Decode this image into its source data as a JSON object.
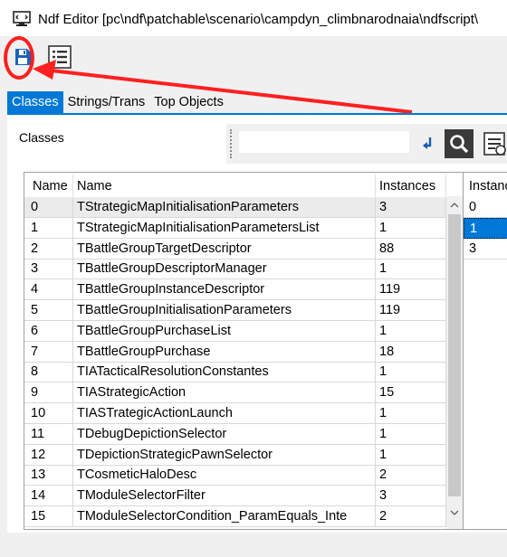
{
  "window": {
    "title": "Ndf Editor [pc\\ndf\\patchable\\scenario\\campdyn_climbnarodnaia\\ndfscript\\",
    "icon": "monitor-icon"
  },
  "toolbar": {
    "save_icon": "floppy-disk-icon",
    "list_icon": "list-view-icon"
  },
  "annotation": {
    "color": "#ff2020"
  },
  "tabs": [
    {
      "label": "Classes",
      "active": true
    },
    {
      "label": "Strings/Trans",
      "active": false
    },
    {
      "label": "Top Objects",
      "active": false
    }
  ],
  "classes_panel": {
    "label": "Classes",
    "search": {
      "value": "",
      "placeholder": ""
    },
    "icons": [
      "clear-arrow-icon",
      "search-icon",
      "properties-icon"
    ]
  },
  "class_table": {
    "columns": [
      "Name",
      "Name",
      "Instances"
    ],
    "rows": [
      [
        "0",
        "TStrategicMapInitialisationParameters",
        "3"
      ],
      [
        "1",
        "TStrategicMapInitialisationParametersList",
        "1"
      ],
      [
        "2",
        "TBattleGroupTargetDescriptor",
        "88"
      ],
      [
        "3",
        "TBattleGroupDescriptorManager",
        "1"
      ],
      [
        "4",
        "TBattleGroupInstanceDescriptor",
        "119"
      ],
      [
        "5",
        "TBattleGroupInitialisationParameters",
        "119"
      ],
      [
        "6",
        "TBattleGroupPurchaseList",
        "1"
      ],
      [
        "7",
        "TBattleGroupPurchase",
        "18"
      ],
      [
        "8",
        "TIATacticalResolutionConstantes",
        "1"
      ],
      [
        "9",
        "TIAStrategicAction",
        "15"
      ],
      [
        "10",
        "TIASTrategicActionLaunch",
        "1"
      ],
      [
        "11",
        "TDebugDepictionSelector",
        "1"
      ],
      [
        "12",
        "TDepictionStrategicPawnSelector",
        "1"
      ],
      [
        "13",
        "TCosmeticHaloDesc",
        "2"
      ],
      [
        "14",
        "TModuleSelectorFilter",
        "3"
      ],
      [
        "15",
        "TModuleSelectorCondition_ParamEquals_Inte",
        "2"
      ]
    ],
    "selected_row": 0
  },
  "instance_table": {
    "header": "Instance",
    "rows": [
      "0",
      "1",
      "3"
    ],
    "selected_row": 1
  },
  "colors": {
    "accent": "#0078d7",
    "selected_row": "#ebebeb"
  }
}
